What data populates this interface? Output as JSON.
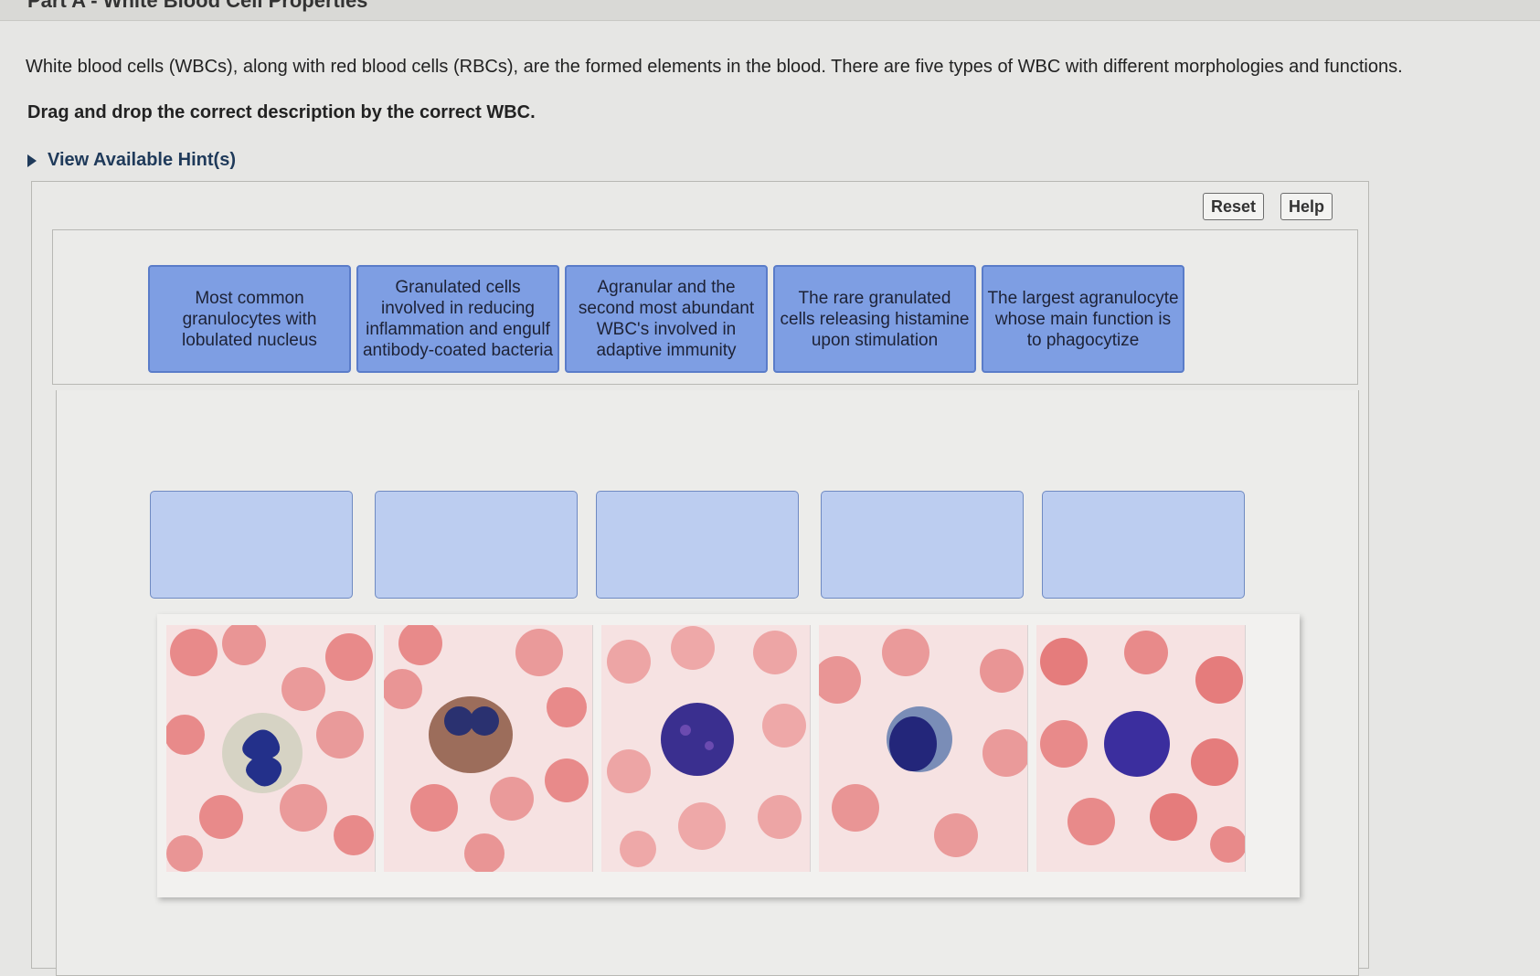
{
  "page": {
    "part_title": "Part A - White Blood Cell Properties",
    "intro": "White blood cells (WBCs), along with red blood cells (RBCs), are the formed elements in the blood. There are five types of WBC with different morphologies and functions.",
    "instruction": "Drag and drop the correct description by the correct WBC.",
    "hint_link": "View Available Hint(s)"
  },
  "toolbar": {
    "reset_label": "Reset",
    "help_label": "Help"
  },
  "labels": [
    "Most common granulocytes with lobulated nucleus",
    "Granulated cells involved in reducing inflammation and engulf antibody-coated bacteria",
    "Agranular and the second most abundant WBC's involved in adaptive immunity",
    "The rare granulated cells releasing histamine upon stimulation",
    "The largest agranulocyte whose main function is to phagocytize"
  ],
  "colors": {
    "label_fill": "#7e9ee3",
    "drop_zone_fill": "#bccdf0",
    "rbc": "#e98a8a",
    "nucleus": "#2a2a8a"
  },
  "images": [
    {
      "icon": "neutrophil-micrograph"
    },
    {
      "icon": "eosinophil-micrograph"
    },
    {
      "icon": "basophil-micrograph"
    },
    {
      "icon": "lymphocyte-micrograph"
    },
    {
      "icon": "monocyte-micrograph"
    }
  ]
}
